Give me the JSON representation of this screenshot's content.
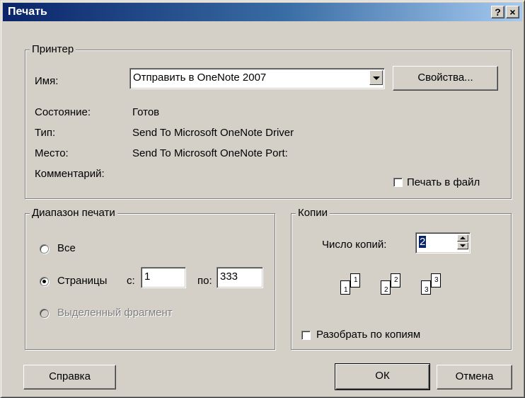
{
  "window": {
    "title": "Печать",
    "help_glyph": "?",
    "close_glyph": "×"
  },
  "printer": {
    "legend": "Принтер",
    "name_label": "Имя:",
    "name_value": "Отправить в OneNote 2007",
    "properties_button": "Свойства...",
    "status_label": "Состояние:",
    "status_value": "Готов",
    "type_label": "Тип:",
    "type_value": "Send To Microsoft OneNote Driver",
    "location_label": "Место:",
    "location_value": "Send To Microsoft OneNote Port:",
    "comment_label": "Комментарий:",
    "print_to_file_label": "Печать в файл",
    "print_to_file_checked": false
  },
  "range": {
    "legend": "Диапазон печати",
    "all_label": "Все",
    "pages_label": "Страницы",
    "from_label": "с:",
    "from_value": "1",
    "to_label": "по:",
    "to_value": "333",
    "selection_label": "Выделенный фрагмент",
    "selected_option": "pages"
  },
  "copies": {
    "legend": "Копии",
    "count_label": "Число копий:",
    "count_value": "2",
    "collate_label": "Разобрать по копиям",
    "collate_checked": false,
    "collate_icon_labels": [
      "1",
      "1",
      "2",
      "2",
      "3",
      "3"
    ]
  },
  "footer": {
    "help_button": "Справка",
    "ok_button": "ОК",
    "cancel_button": "Отмена"
  },
  "colors": {
    "dialog_face": "#d4d0c8",
    "titlebar_start": "#0a246a",
    "titlebar_end": "#a6caf0",
    "selection": "#0a246a"
  }
}
